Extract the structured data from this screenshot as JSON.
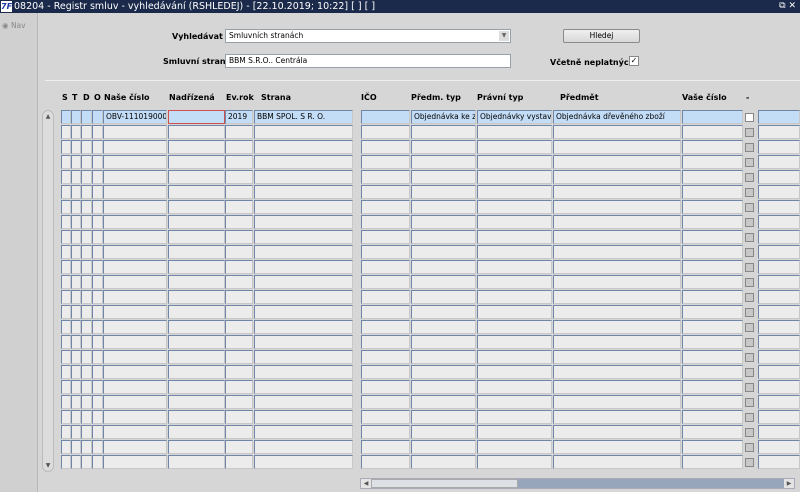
{
  "window": {
    "title": "08204 - Registr smluv - vyhledávání (RSHLEDEJ) - [22.10.2019; 10:22]  [ ]  [ ]",
    "logo": "7F",
    "restore_icon": "⧉",
    "close_icon": "✕"
  },
  "nav": {
    "label": "Nav"
  },
  "form": {
    "search_in_label": "Vyhledávat v",
    "search_in_value": "Smluvních stranách",
    "search_button": "Hledej",
    "party_label": "Smluvní strana",
    "party_value": "BBM S.R.O.. Centrála",
    "include_invalid_label": "Včetně neplatných",
    "include_invalid_checked": true
  },
  "columns": [
    "S",
    "T",
    "D",
    "O",
    "Naše číslo",
    "Nadřízená",
    "Ev.rok",
    "Strana",
    "IČO",
    "Předm. typ",
    "Právní typ",
    "Předmět",
    "Vaše číslo",
    "-"
  ],
  "rows": [
    {
      "s": "",
      "t": "",
      "d": "",
      "o": "",
      "nase_cislo": "OBV-111019000",
      "nadrizena": "",
      "ev_rok": "2019",
      "strana": "BBM SPOL. S R. O.",
      "ico": "",
      "predm_typ": "Objednávka ke zv",
      "pravni_typ": "Objednávky vystave",
      "predmet": "Objednávka dřevěného zboží",
      "vase_cislo": "",
      "checked": false,
      "last": ""
    }
  ],
  "empty_row_count": 23
}
